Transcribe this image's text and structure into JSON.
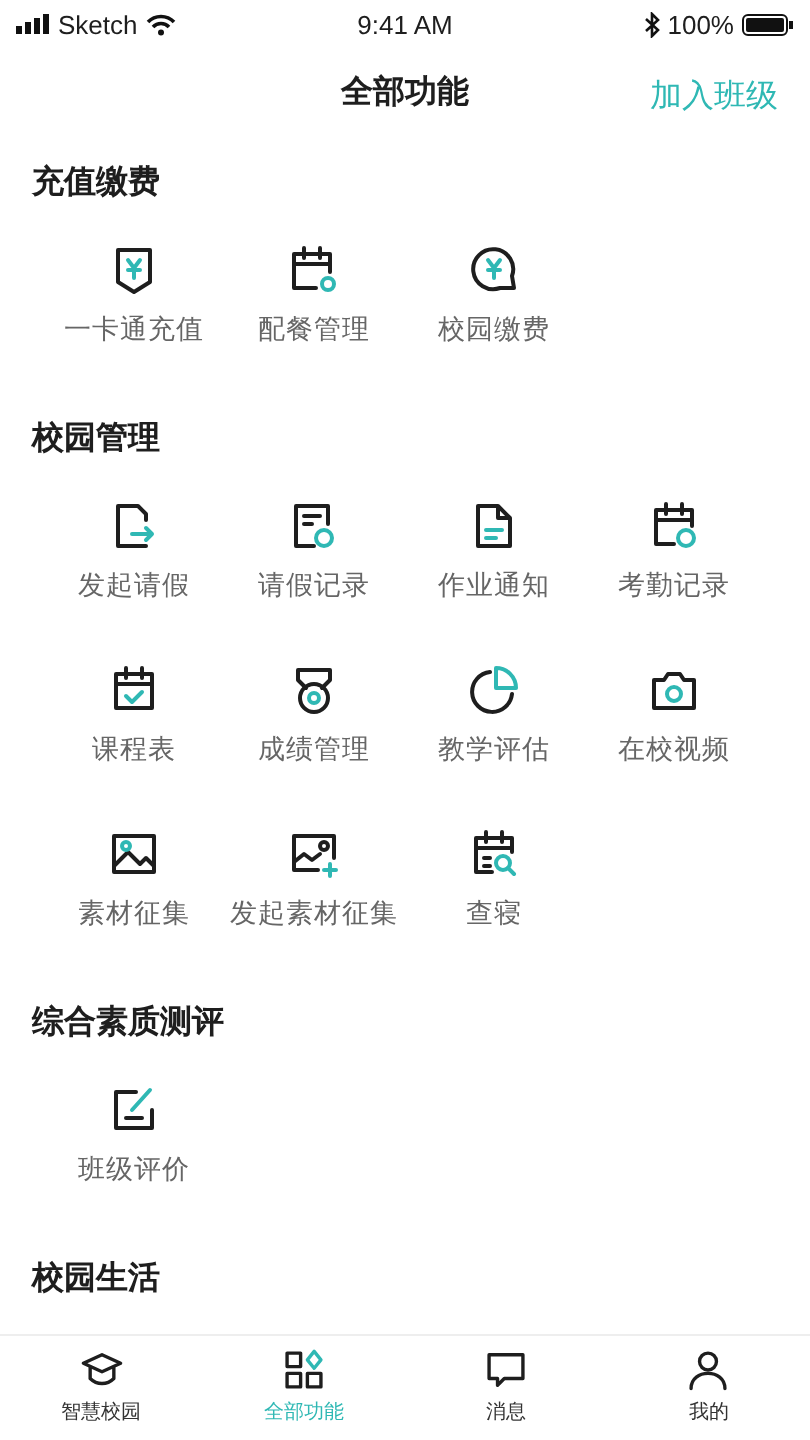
{
  "status_bar": {
    "carrier": "Sketch",
    "time": "9:41 AM",
    "battery": "100%"
  },
  "nav": {
    "title": "全部功能",
    "action": "加入班级"
  },
  "sections": [
    {
      "title": "充值缴费",
      "items": [
        {
          "label": "一卡通充值"
        },
        {
          "label": "配餐管理"
        },
        {
          "label": "校园缴费"
        }
      ]
    },
    {
      "title": "校园管理",
      "items": [
        {
          "label": "发起请假"
        },
        {
          "label": "请假记录"
        },
        {
          "label": "作业通知"
        },
        {
          "label": "考勤记录"
        },
        {
          "label": "课程表"
        },
        {
          "label": "成绩管理"
        },
        {
          "label": "教学评估"
        },
        {
          "label": "在校视频"
        },
        {
          "label": "素材征集"
        },
        {
          "label": "发起素材征集"
        },
        {
          "label": "查寝"
        }
      ]
    },
    {
      "title": "综合素质测评",
      "items": [
        {
          "label": "班级评价"
        }
      ]
    },
    {
      "title": "校园生活"
    }
  ],
  "tab_bar": [
    {
      "label": "智慧校园",
      "selected": false
    },
    {
      "label": "全部功能",
      "selected": true
    },
    {
      "label": "消息",
      "selected": false
    },
    {
      "label": "我的",
      "selected": false
    }
  ]
}
